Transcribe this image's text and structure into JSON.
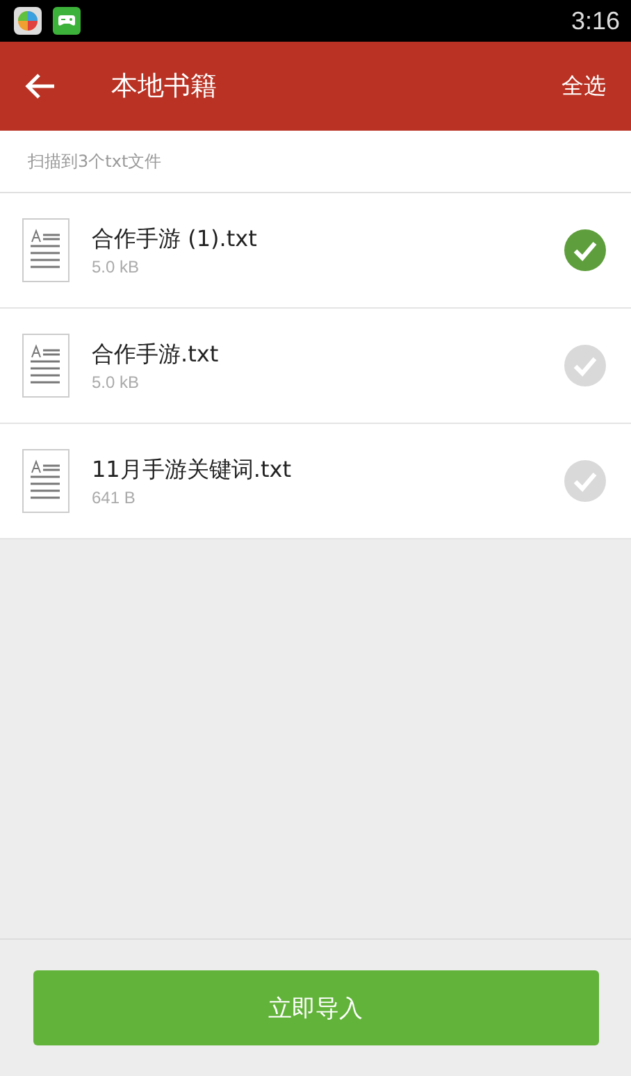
{
  "status_bar": {
    "time": "3:16"
  },
  "app_bar": {
    "title": "本地书籍",
    "action": "全选"
  },
  "summary": "扫描到3个txt文件",
  "files": [
    {
      "name": "合作手游 (1).txt",
      "size": "5.0 kB",
      "selected": true
    },
    {
      "name": "合作手游.txt",
      "size": "5.0 kB",
      "selected": false
    },
    {
      "name": "11月手游关键词.txt",
      "size": "641 B",
      "selected": false
    }
  ],
  "import_button": "立即导入"
}
